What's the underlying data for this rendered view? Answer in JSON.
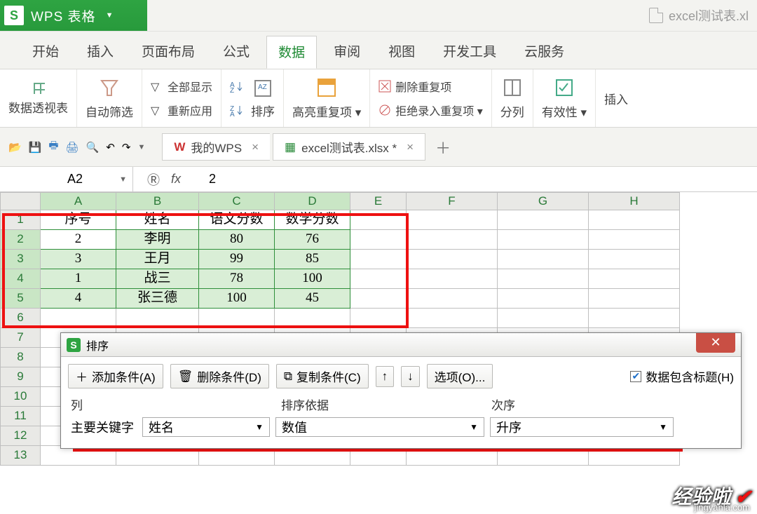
{
  "app": {
    "title": "WPS 表格",
    "doc_title": "excel测试表.xl"
  },
  "menu": {
    "tabs": [
      "开始",
      "插入",
      "页面布局",
      "公式",
      "数据",
      "审阅",
      "视图",
      "开发工具",
      "云服务"
    ],
    "active": 4
  },
  "ribbon": {
    "pivot": "数据透视表",
    "auto_filter": "自动筛选",
    "show_all": "全部显示",
    "reapply": "重新应用",
    "sort": "排序",
    "highlight_dup": "高亮重复项",
    "del_dup": "删除重复项",
    "reject_dup": "拒绝录入重复项",
    "split": "分列",
    "validity": "有效性",
    "insert": "插入"
  },
  "qat": {
    "mywps": "我的WPS",
    "doc_tab": "excel测试表.xlsx *"
  },
  "namebox": {
    "ref": "A2",
    "formula": "2"
  },
  "grid": {
    "cols": [
      "A",
      "B",
      "C",
      "D",
      "E",
      "F",
      "G",
      "H"
    ],
    "rows_visible": [
      1,
      2,
      3,
      4,
      5,
      6,
      7,
      8,
      9,
      10,
      11,
      12,
      13
    ],
    "headers": [
      "序号",
      "姓名",
      "语文分数",
      "数学分数"
    ],
    "data": [
      {
        "no": "2",
        "name": "李明",
        "cn": "80",
        "math": "76"
      },
      {
        "no": "3",
        "name": "王月",
        "cn": "99",
        "math": "85"
      },
      {
        "no": "1",
        "name": "战三",
        "cn": "78",
        "math": "100"
      },
      {
        "no": "4",
        "name": "张三德",
        "cn": "100",
        "math": "45"
      }
    ]
  },
  "dialog": {
    "title": "排序",
    "add": "添加条件(A)",
    "del": "删除条件(D)",
    "copy": "复制条件(C)",
    "options": "选项(O)...",
    "has_header": "数据包含标题(H)",
    "col_header": "列",
    "basis_header": "排序依据",
    "order_header": "次序",
    "primary_label": "主要关键字",
    "field": "姓名",
    "basis": "数值",
    "order": "升序"
  },
  "watermark": {
    "text": "经验啦",
    "site": "jingyanla.com"
  }
}
